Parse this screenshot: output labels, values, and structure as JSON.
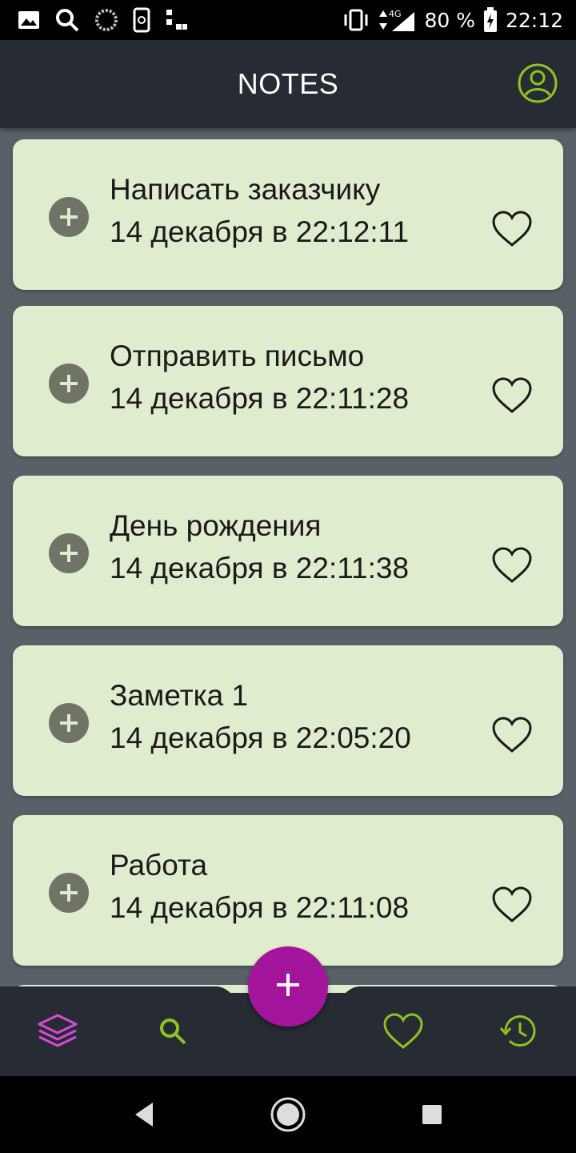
{
  "status_bar": {
    "battery": "80 %",
    "time": "22:12",
    "network": "4G",
    "left_icons": [
      "image-icon",
      "search-icon",
      "sync-icon",
      "screenshot-icon",
      "dots-icon"
    ]
  },
  "app_bar": {
    "title": "NOTES",
    "profile_icon": "account-circle-icon"
  },
  "notes": [
    {
      "title": "Написать заказчику",
      "date": "14 декабря в 22:12:11",
      "favorite": false
    },
    {
      "title": "Отправить письмо",
      "date": "14 декабря в 22:11:28",
      "favorite": false
    },
    {
      "title": "День рождения",
      "date": "14 декабря в 22:11:38",
      "favorite": false
    },
    {
      "title": "Заметка 1",
      "date": "14 декабря в 22:05:20",
      "favorite": false
    },
    {
      "title": "Работа",
      "date": "14 декабря в 22:11:08",
      "favorite": false
    }
  ],
  "fab": {
    "icon": "plus-icon"
  },
  "bottom_nav": [
    {
      "name": "notes",
      "icon": "layers-icon",
      "active": true
    },
    {
      "name": "search",
      "icon": "search-icon",
      "active": false
    },
    {
      "name": "favorites",
      "icon": "heart-icon",
      "active": false
    },
    {
      "name": "history",
      "icon": "history-icon",
      "active": false
    }
  ],
  "colors": {
    "accent": "#a3169b",
    "active_nav": "#d64ad8",
    "icon_green": "#8fc31f",
    "card_bg": "#dfecce",
    "app_bar": "#262b34",
    "list_bg": "#5a6068"
  }
}
